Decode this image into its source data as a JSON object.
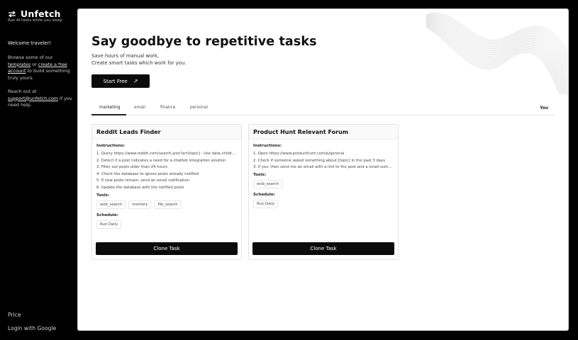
{
  "sidebar": {
    "brand": "Unfetch",
    "tagline": "Run AI tasks while you sleep",
    "welcome": "Welcome traveler!",
    "browse_prefix": "Browse some of our",
    "templates_link": "templates",
    "or_text": "or",
    "create_link": "create a free account",
    "browse_suffix": "to build something truly yours.",
    "reach_prefix": "Reach out at",
    "support_email": "support@unfetch.com",
    "reach_suffix": "if you need help.",
    "price": "Price",
    "login": "Login with Google"
  },
  "hero": {
    "title": "Say goodbye to repetitive tasks",
    "subtitle_line1": "Save hours of manual work,",
    "subtitle_line2": "Create smart tasks which work for you.",
    "start_button": "Start Free",
    "start_arrow": "↗"
  },
  "tabs": {
    "items": [
      "marketing",
      "email",
      "finance",
      "personal"
    ],
    "active": "marketing",
    "right_label": "You"
  },
  "cards": [
    {
      "title": "Reddit Leads Finder",
      "instructions_label": "Instructions:",
      "instructions": [
        "1. Query https://www.reddit.com/search.json?q=[topic] - Use data.children...",
        "2. Detect if a post indicates a need for a chatbot integration solution",
        "3. Filter out posts older than 24 hours",
        "4. Check the database to ignore posts already notified",
        "5. If new posts remain, send an email notification",
        "6. Update the database with the notified posts"
      ],
      "tools_label": "Tools:",
      "tools": [
        "web_search",
        "memory",
        "file_search"
      ],
      "schedule_label": "Schedule:",
      "schedule": "Run Daily",
      "clone_button": "Clone Task"
    },
    {
      "title": "Product Hunt Relevant Forum",
      "instructions_label": "Instructions:",
      "instructions": [
        "1. Open https://www.producthunt.com/p/general",
        "2. Check if someone asked something about [topic] in the past 3 days",
        "3. If yes, then send me an email with a link to the post and a small summa..."
      ],
      "tools_label": "Tools:",
      "tools": [
        "web_search"
      ],
      "schedule_label": "Schedule:",
      "schedule": "Run Daily",
      "clone_button": "Clone Task"
    }
  ],
  "colors": {
    "background": "#000000",
    "panel": "#ffffff",
    "button": "#0b0b0b",
    "panel_border": "#c9d3dc"
  },
  "icons": {
    "brand": "arrows-swap-icon",
    "start_arrow": "arrow-up-right-icon"
  }
}
